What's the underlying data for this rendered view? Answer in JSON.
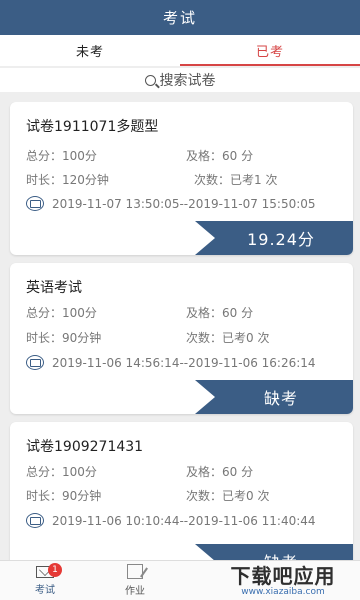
{
  "header": {
    "title": "考试"
  },
  "tabs": [
    {
      "label": "未考",
      "active": false
    },
    {
      "label": "已考",
      "active": true
    }
  ],
  "search": {
    "placeholder": "搜索试卷"
  },
  "exams": [
    {
      "title": "试卷1911071多题型",
      "total": "总分：100分",
      "pass": "及格：60 分",
      "duration": "时长：120分钟",
      "attempts": "次数：已考1 次",
      "time_range": "2019-11-07 13:50:05--2019-11-07 15:50:05",
      "result": "19.24分"
    },
    {
      "title": "英语考试",
      "total": "总分：100分",
      "pass": "及格：60 分",
      "duration": "时长：90分钟",
      "attempts": "次数：已考0 次",
      "time_range": "2019-11-06 14:56:14--2019-11-06 16:26:14",
      "result": "缺考"
    },
    {
      "title": "试卷1909271431",
      "total": "总分：100分",
      "pass": "及格：60 分",
      "duration": "时长：90分钟",
      "attempts": "次数：已考0 次",
      "time_range": "2019-11-06 10:10:44--2019-11-06 11:40:44",
      "result": "缺考"
    }
  ],
  "bottom_nav": [
    {
      "label": "考试",
      "badge": "1",
      "active": true,
      "icon": "envelope-icon"
    },
    {
      "label": "作业",
      "active": false,
      "icon": "edit-icon"
    }
  ],
  "watermark": {
    "text": "下载吧应用",
    "url": "www.xiazaiba.com"
  },
  "colors": {
    "primary": "#3b5d85",
    "accent": "#d64545",
    "badge": "#e53935"
  }
}
